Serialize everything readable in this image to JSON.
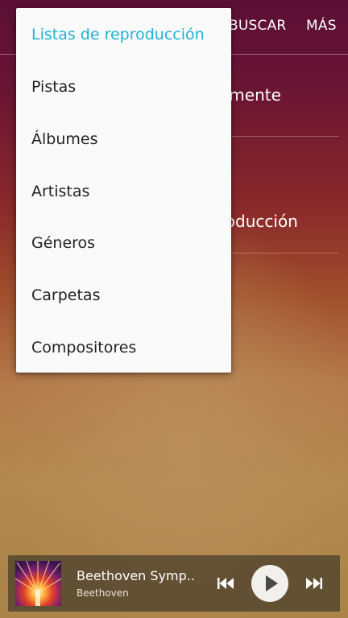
{
  "topbar": {
    "search_label": "BUSCAR",
    "more_label": "MÁS"
  },
  "background_list": {
    "item1_visible": "emente",
    "item2_visible": "roducción"
  },
  "dropdown": {
    "items": [
      {
        "label": "Listas de reproducción",
        "selected": true
      },
      {
        "label": "Pistas",
        "selected": false
      },
      {
        "label": "Álbumes",
        "selected": false
      },
      {
        "label": "Artistas",
        "selected": false
      },
      {
        "label": "Géneros",
        "selected": false
      },
      {
        "label": "Carpetas",
        "selected": false
      },
      {
        "label": "Compositores",
        "selected": false
      }
    ]
  },
  "player": {
    "title": "Beethoven Symp..",
    "artist": "Beethoven",
    "icons": {
      "previous": "skip-previous-icon",
      "play": "play-icon",
      "next": "skip-next-icon"
    }
  },
  "colors": {
    "accent": "#1eb3d7",
    "menu_bg": "#fafafa",
    "menu_text": "#222222"
  }
}
